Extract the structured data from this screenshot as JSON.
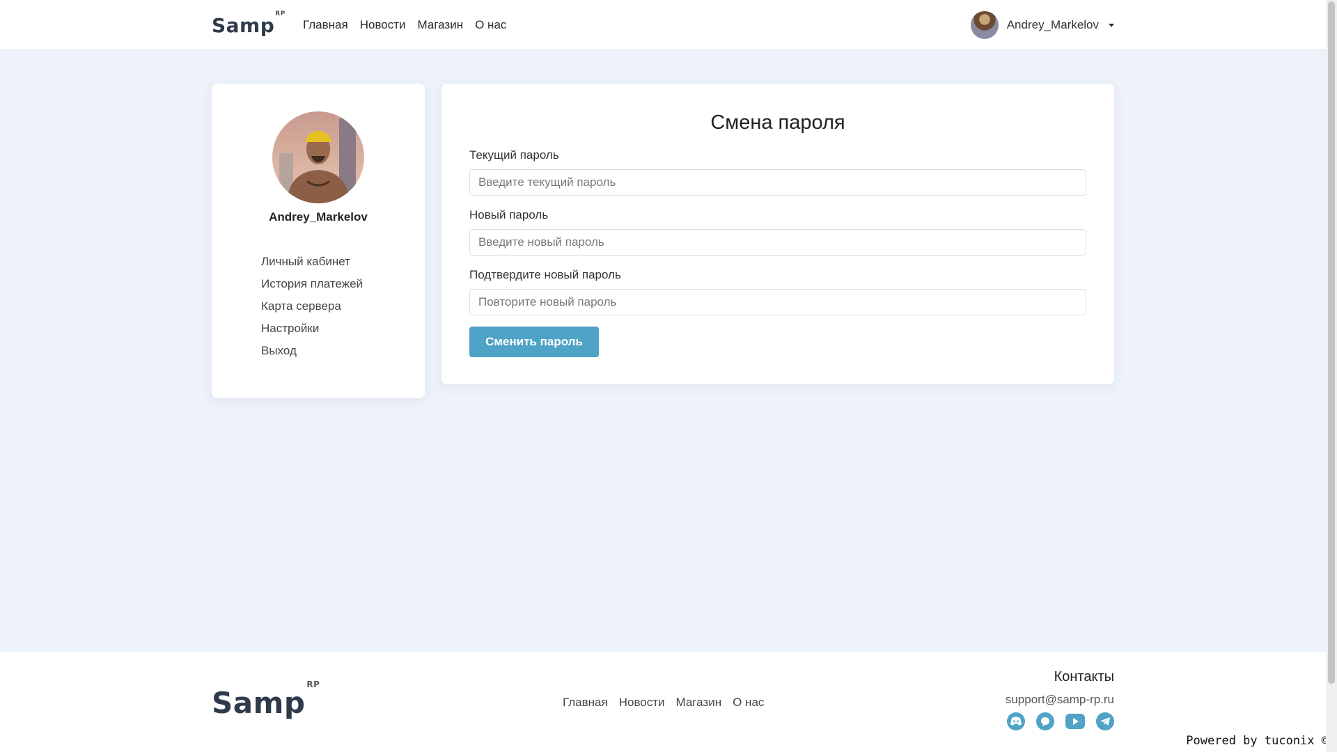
{
  "header": {
    "logo": "Samp",
    "logo_sup": "RP",
    "nav": [
      "Главная",
      "Новости",
      "Магазин",
      "О нас"
    ],
    "user_name": "Andrey_Markelov"
  },
  "sidebar": {
    "user_name": "Andrey_Markelov",
    "links": [
      "Личный кабинет",
      "История платежей",
      "Карта сервера",
      "Настройки",
      "Выход"
    ]
  },
  "form": {
    "title": "Смена пароля",
    "current_label": "Текущий пароль",
    "current_placeholder": "Введите текущий пароль",
    "new_label": "Новый пароль",
    "new_placeholder": "Введите новый пароль",
    "confirm_label": "Подтвердите новый пароль",
    "confirm_placeholder": "Повторите новый пароль",
    "submit_label": "Сменить пароль"
  },
  "footer": {
    "logo": "Samp",
    "logo_sup": "RP",
    "nav": [
      "Главная",
      "Новости",
      "Магазин",
      "О нас"
    ],
    "contacts_title": "Контакты",
    "email": "support@samp-rp.ru",
    "socials": [
      "discord-icon",
      "chat-icon",
      "youtube-icon",
      "telegram-icon"
    ]
  },
  "powered_by": "Powered by tuconix ©",
  "colors": {
    "accent": "#4fa3c7",
    "page_bg": "#eef2fa"
  }
}
